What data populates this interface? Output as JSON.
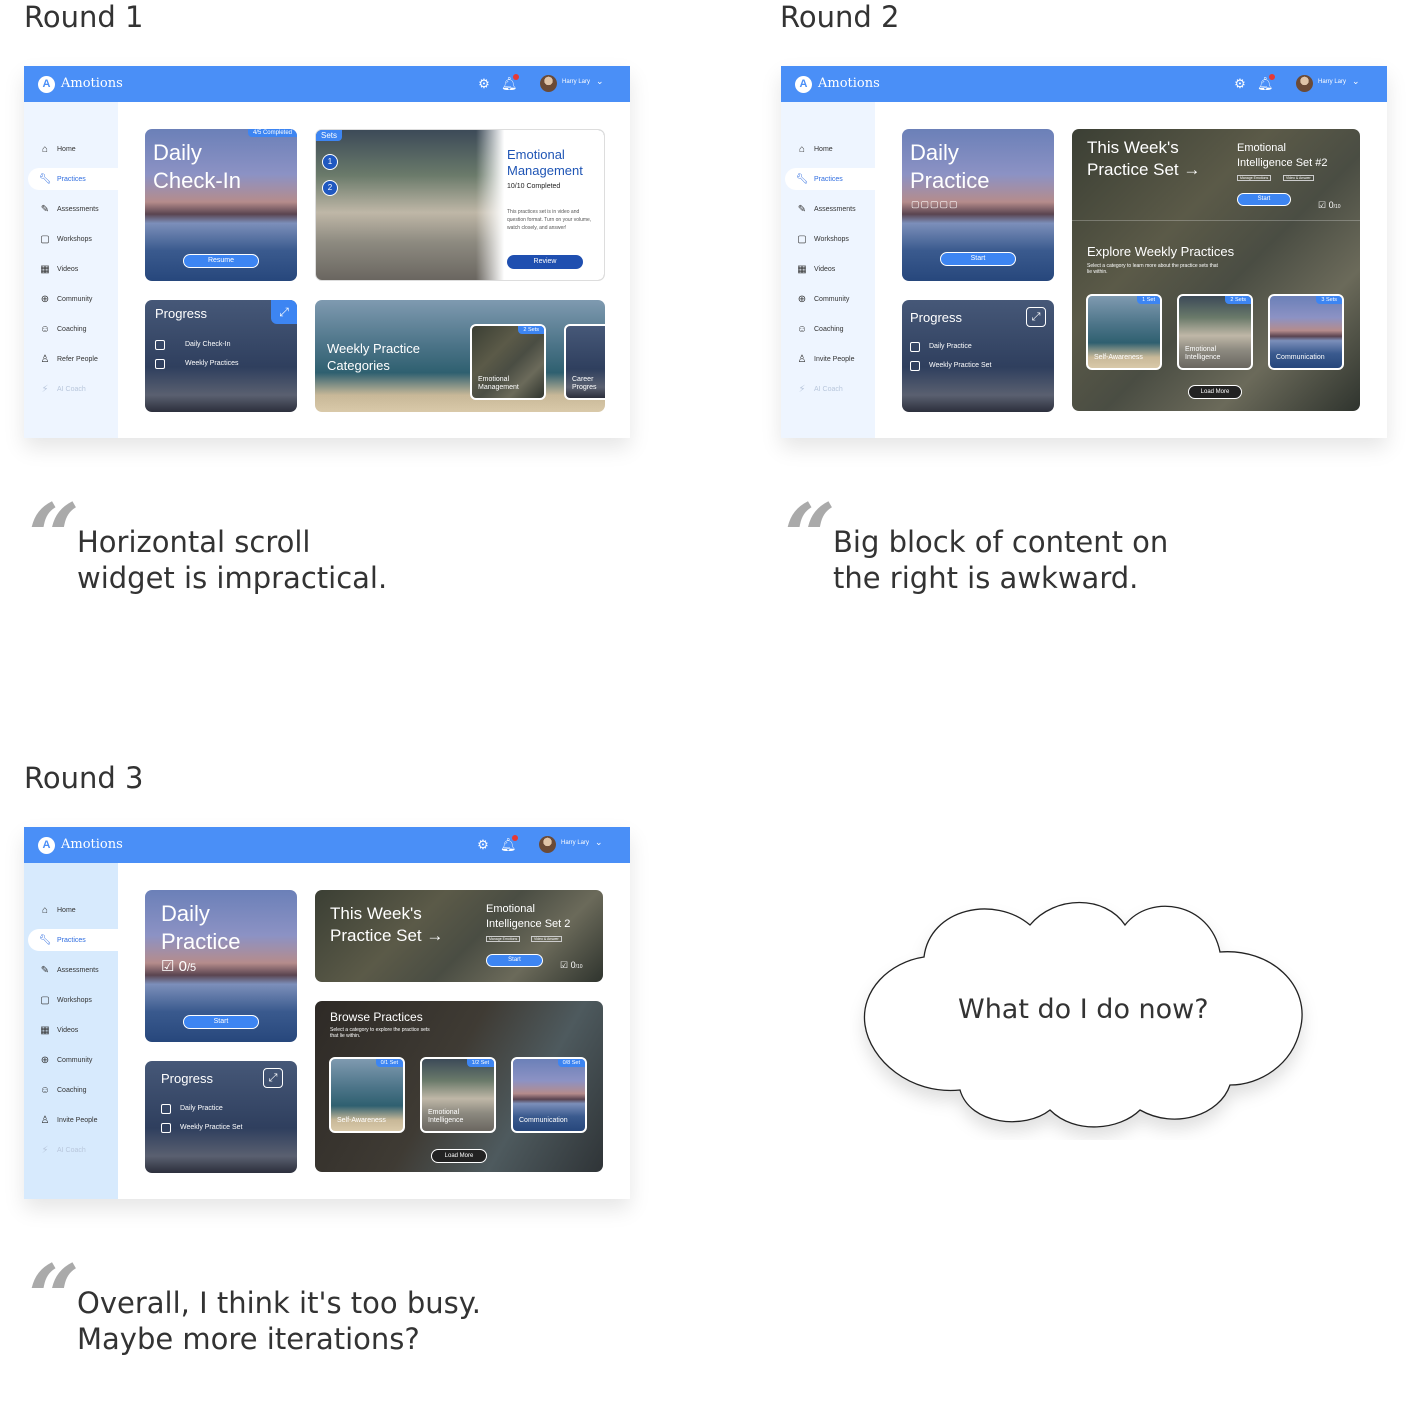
{
  "rounds": [
    {
      "title": "Round 1",
      "app": {
        "brand": "Amotions",
        "user": "Harry Lary",
        "sidebar": [
          {
            "label": "Home",
            "icon": "home-icon"
          },
          {
            "label": "Practices",
            "icon": "wrench-icon",
            "active": true
          },
          {
            "label": "Assessments",
            "icon": "pencil-icon"
          },
          {
            "label": "Workshops",
            "icon": "clipboard-icon"
          },
          {
            "label": "Videos",
            "icon": "film-icon"
          },
          {
            "label": "Community",
            "icon": "globe-icon"
          },
          {
            "label": "Coaching",
            "icon": "coaching-icon"
          },
          {
            "label": "Refer People",
            "icon": "add-person-icon"
          },
          {
            "label": "AI Coach",
            "icon": "lightning-icon",
            "disabled": true
          }
        ],
        "checkin": {
          "title_line1": "Daily",
          "title_line2": "Check-In",
          "badge": "4/5 Completed",
          "button": "Resume"
        },
        "sets": {
          "tag": "Sets",
          "step1": "1",
          "step2": "2",
          "title_line1": "Emotional",
          "title_line2": "Management",
          "completed": "10/10 Completed",
          "desc": "This practices set is in video and question format. Turn on your volume, watch closely, and answer!",
          "button": "Review"
        },
        "progress": {
          "title": "Progress",
          "items": [
            "Daily Check-In",
            "Weekly Practices"
          ]
        },
        "weekly": {
          "title_line1": "Weekly Practice",
          "title_line2": "Categories",
          "card1_tag": "2 Sets",
          "card1_line1": "Emotional",
          "card1_line2": "Management",
          "card2_line1": "Career",
          "card2_line2": "Progres"
        }
      },
      "quote_line1": "Horizontal scroll",
      "quote_line2": "widget is impractical."
    },
    {
      "title": "Round 2",
      "app": {
        "brand": "Amotions",
        "user": "Harry Lary",
        "sidebar": [
          {
            "label": "Home",
            "icon": "home-icon"
          },
          {
            "label": "Practices",
            "icon": "wrench-icon",
            "active": true
          },
          {
            "label": "Assessments",
            "icon": "pencil-icon"
          },
          {
            "label": "Workshops",
            "icon": "clipboard-icon"
          },
          {
            "label": "Videos",
            "icon": "film-icon"
          },
          {
            "label": "Community",
            "icon": "globe-icon"
          },
          {
            "label": "Coaching",
            "icon": "coaching-icon"
          },
          {
            "label": "Invite People",
            "icon": "add-person-icon"
          },
          {
            "label": "AI Coach",
            "icon": "lightning-icon",
            "disabled": true
          }
        ],
        "daily": {
          "title_line1": "Daily",
          "title_line2": "Practice",
          "button": "Start"
        },
        "week": {
          "title_line1": "This Week's",
          "title_line2": "Practice Set →",
          "set_line1": "Emotional",
          "set_line2": "Intelligence Set #2",
          "chip1": "Manage Emotions",
          "chip2": "Video & Answer",
          "button": "Start",
          "count": "0",
          "count_total": "/10"
        },
        "explore": {
          "title": "Explore Weekly Practices",
          "subtitle": "Select a category to learn more about the practice sets that lie within.",
          "cards": [
            {
              "label": "Self-Awareness",
              "tag": "1 Set"
            },
            {
              "label": "Emotional Intelligence",
              "tag": "2 Sets"
            },
            {
              "label": "Communication",
              "tag": "3 Sets"
            }
          ],
          "button": "Load More"
        },
        "progress": {
          "title": "Progress",
          "items": [
            "Daily Practice",
            "Weekly Practice Set"
          ]
        }
      },
      "quote_line1": "Big block of content on",
      "quote_line2": "the right is awkward."
    },
    {
      "title": "Round 3",
      "app": {
        "brand": "Amotions",
        "user": "Harry Lary",
        "sidebar": [
          {
            "label": "Home",
            "icon": "home-icon"
          },
          {
            "label": "Practices",
            "icon": "wrench-icon",
            "active": true
          },
          {
            "label": "Assessments",
            "icon": "pencil-icon"
          },
          {
            "label": "Workshops",
            "icon": "clipboard-icon"
          },
          {
            "label": "Videos",
            "icon": "film-icon"
          },
          {
            "label": "Community",
            "icon": "globe-icon"
          },
          {
            "label": "Coaching",
            "icon": "coaching-icon"
          },
          {
            "label": "Invite People",
            "icon": "add-person-icon"
          },
          {
            "label": "AI Coach",
            "icon": "lightning-icon",
            "disabled": true
          }
        ],
        "daily": {
          "title_line1": "Daily",
          "title_line2": "Practice",
          "count": "0",
          "count_total": "/5",
          "button": "Start"
        },
        "week": {
          "title_line1": "This Week's",
          "title_line2": "Practice Set →",
          "set_line1": "Emotional",
          "set_line2": "Intelligence Set 2",
          "chip1": "Manage Emotions",
          "chip2": "Video & Answer",
          "button": "Start",
          "count": "0",
          "count_total": "/10"
        },
        "browse": {
          "title": "Browse Practices",
          "subtitle": "Select a category to explore the practice sets that lie within.",
          "cards": [
            {
              "label": "Self-Awareness",
              "tag": "0/1 Set"
            },
            {
              "label": "Emotional Intelligence",
              "tag": "1/2 Set"
            },
            {
              "label": "Communication",
              "tag": "0/8 Set"
            }
          ],
          "button": "Load More"
        },
        "progress": {
          "title": "Progress",
          "items": [
            "Daily Practice",
            "Weekly Practice Set"
          ]
        }
      },
      "quote_line1": "Overall, I think it's too busy.",
      "quote_line2": "Maybe more iterations?"
    }
  ],
  "cloud": {
    "text": "What do I do now?"
  },
  "colors": {
    "accent": "#4a8ff7",
    "sidebar_bg": "#ddeeff",
    "button": "#3d85f2",
    "active": "#2f6de0"
  }
}
